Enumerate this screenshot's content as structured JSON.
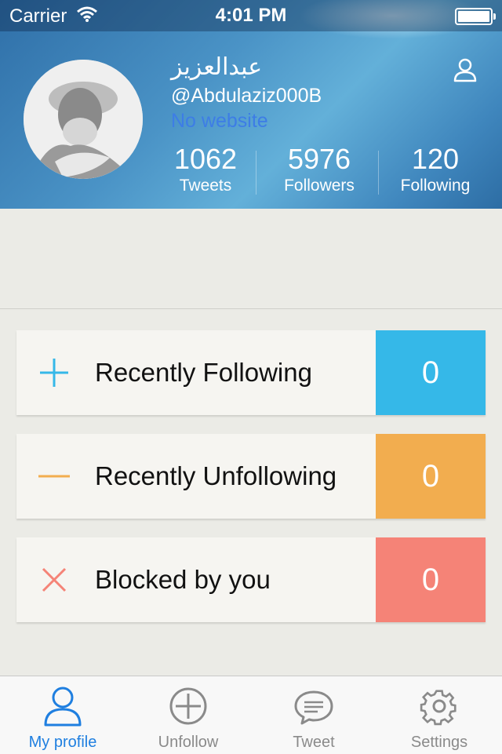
{
  "status_bar": {
    "carrier": "Carrier",
    "time": "4:01 PM"
  },
  "profile": {
    "name": "عبدالعزيز",
    "handle": "@Abdulaziz000B",
    "website": "No website",
    "stats": [
      {
        "value": "1062",
        "label": "Tweets"
      },
      {
        "value": "5976",
        "label": "Followers"
      },
      {
        "value": "120",
        "label": "Following"
      }
    ]
  },
  "cards": [
    {
      "label": "Recently Following",
      "count": "0",
      "icon": "plus-icon",
      "color": "#35b8e8"
    },
    {
      "label": "Recently Unfollowing",
      "count": "0",
      "icon": "minus-icon",
      "color": "#f2ad4f"
    },
    {
      "label": "Blocked by you",
      "count": "0",
      "icon": "cross-icon",
      "color": "#f58377"
    }
  ],
  "tabs": [
    {
      "label": "My profile",
      "icon": "person-icon",
      "active": true
    },
    {
      "label": "Unfollow",
      "icon": "circle-plus-icon",
      "active": false
    },
    {
      "label": "Tweet",
      "icon": "speech-bubble-icon",
      "active": false
    },
    {
      "label": "Settings",
      "icon": "gear-icon",
      "active": false
    }
  ],
  "colors": {
    "accent": "#1f7fe0",
    "tab_inactive": "#8a8a8a"
  }
}
